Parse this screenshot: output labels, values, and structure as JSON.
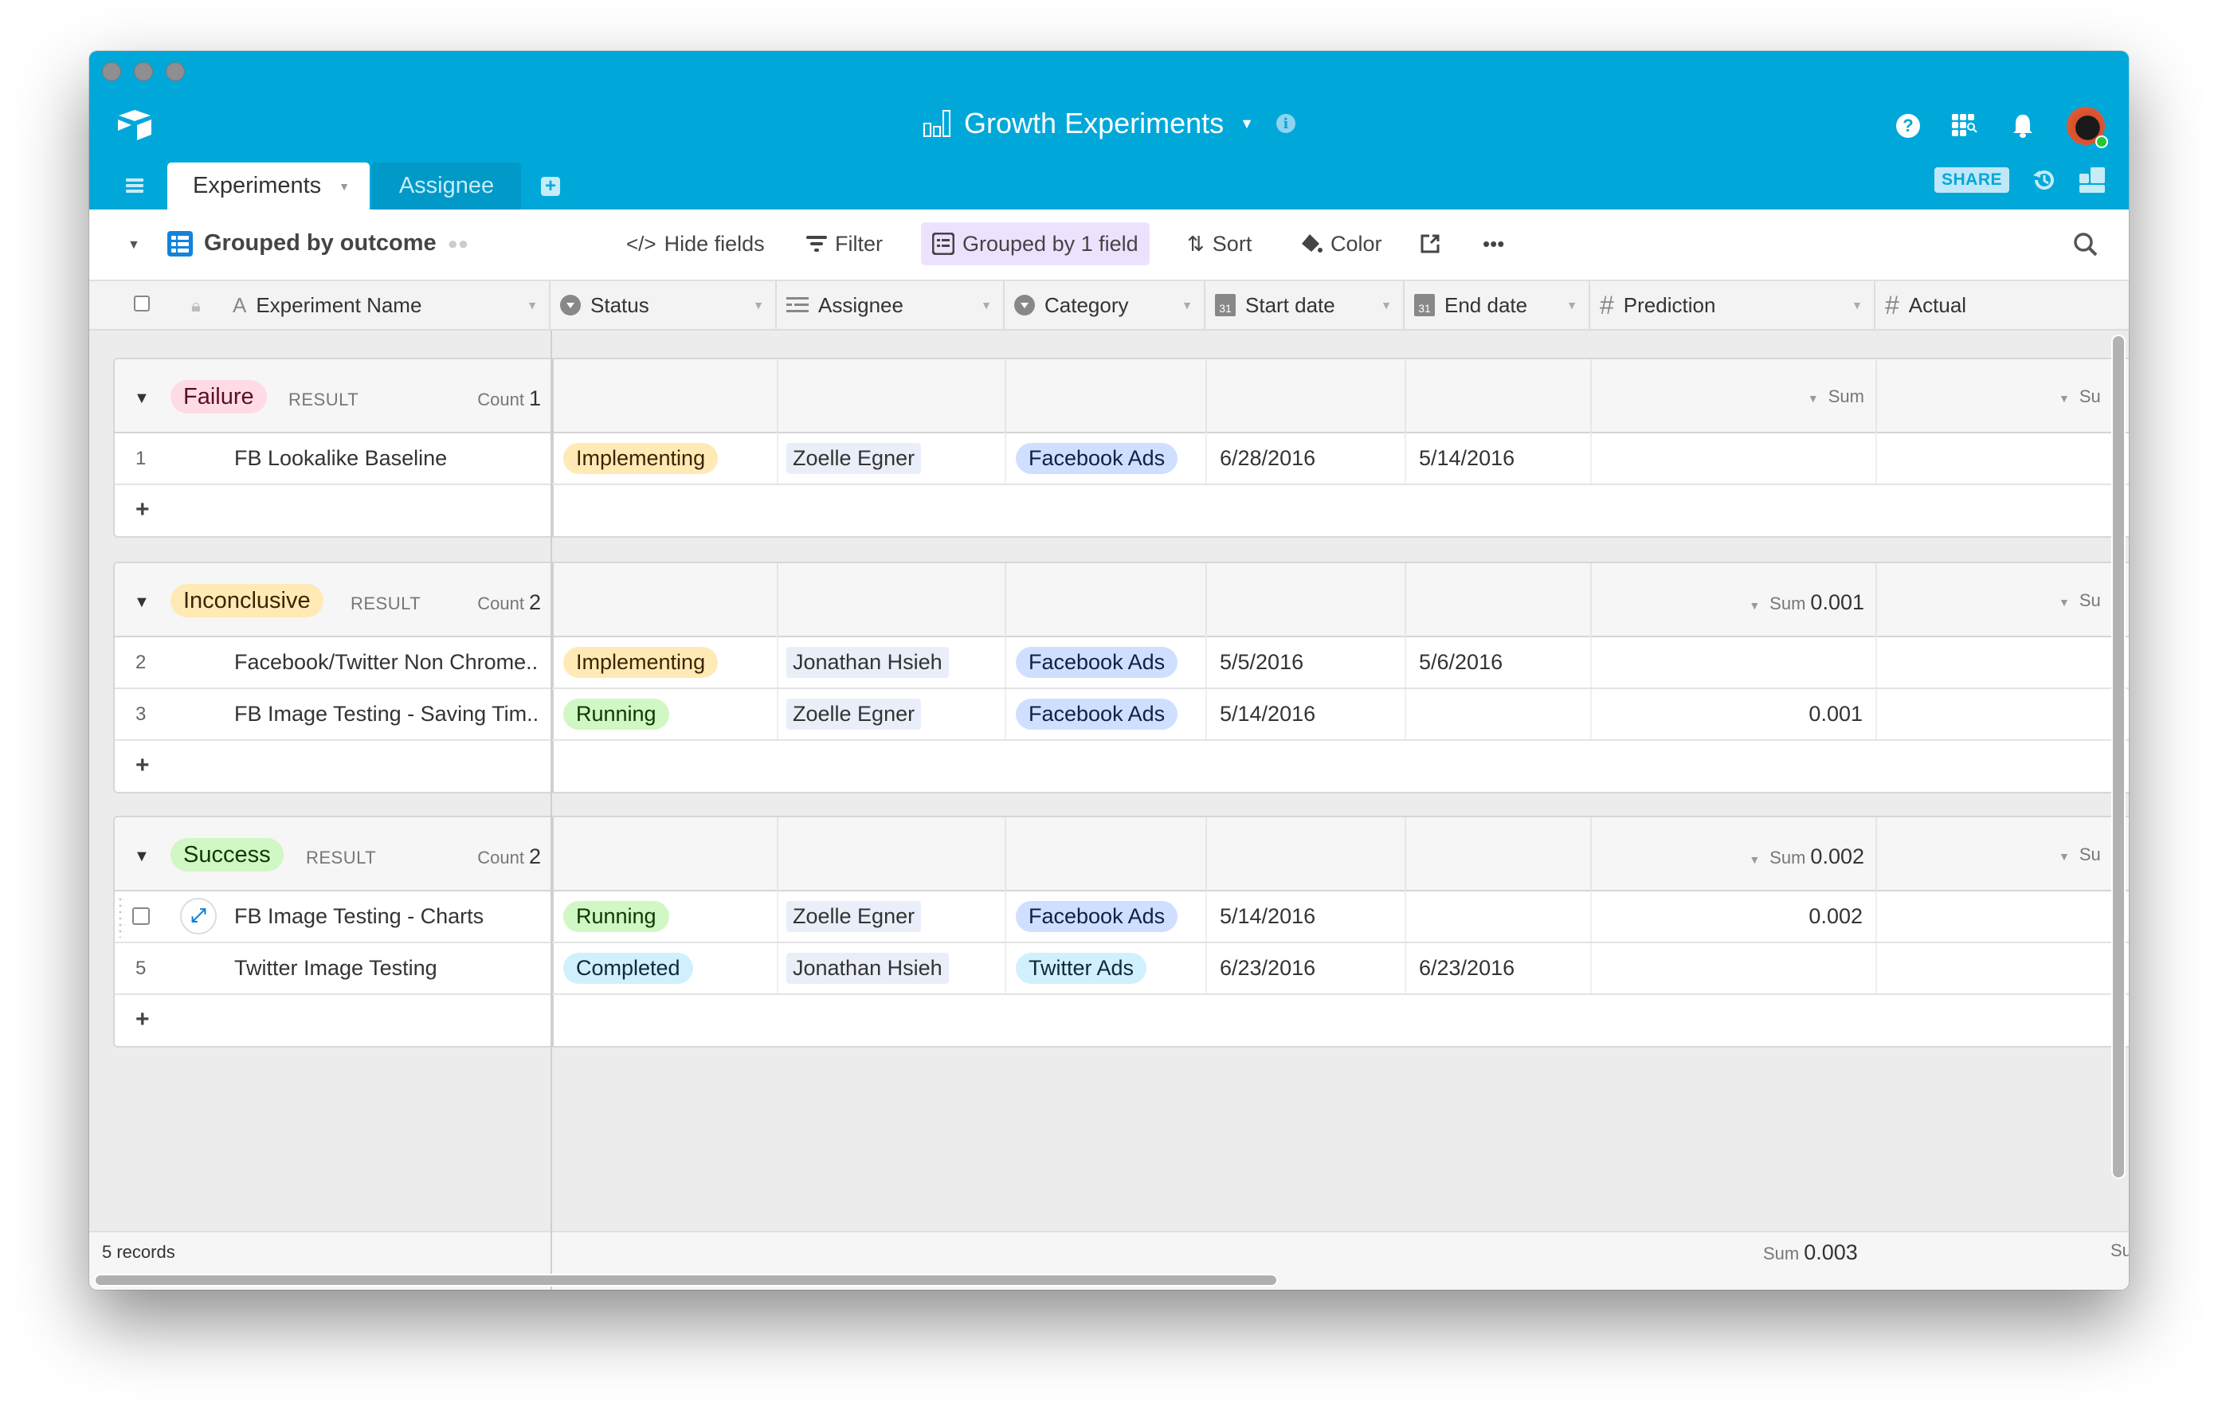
{
  "window": {
    "title": "Growth Experiments",
    "accent_color": "#00a8da"
  },
  "header": {
    "icons": [
      "help-icon",
      "apps-search-icon",
      "bell-icon",
      "avatar"
    ],
    "share_label": "SHARE"
  },
  "tabs": [
    {
      "label": "Experiments",
      "active": true
    },
    {
      "label": "Assignee",
      "active": false
    }
  ],
  "toolbar": {
    "view_name": "Grouped by outcome",
    "hide_fields": "Hide fields",
    "filter": "Filter",
    "group": "Grouped by 1 field",
    "sort": "Sort",
    "color": "Color"
  },
  "columns": [
    {
      "label": "Experiment Name",
      "icon": "text-field-icon"
    },
    {
      "label": "Status",
      "icon": "single-select-icon"
    },
    {
      "label": "Assignee",
      "icon": "collaborator-icon"
    },
    {
      "label": "Category",
      "icon": "single-select-icon"
    },
    {
      "label": "Start date",
      "icon": "calendar-icon"
    },
    {
      "label": "End date",
      "icon": "calendar-icon"
    },
    {
      "label": "Prediction",
      "icon": "number-icon"
    },
    {
      "label": "Actual",
      "icon": "number-icon"
    }
  ],
  "groups": [
    {
      "name": "Failure",
      "field_label": "RESULT",
      "count_label": "Count",
      "count": "1",
      "sum_label": "Sum",
      "sum_value": "",
      "actual_sum_label": "Su",
      "badge_bg": "#ffdce5",
      "badge_fg": "#5a0e27",
      "rows": [
        {
          "num": "1",
          "name": "FB Lookalike Baseline",
          "status": "Implementing",
          "assignee": "Zoelle Egner",
          "category": "Facebook Ads",
          "start": "6/28/2016",
          "end": "5/14/2016",
          "prediction": "",
          "actual": ""
        }
      ]
    },
    {
      "name": "Inconclusive",
      "field_label": "RESULT",
      "count_label": "Count",
      "count": "2",
      "sum_label": "Sum",
      "sum_value": "0.001",
      "actual_sum_label": "Su",
      "badge_bg": "#ffeab6",
      "badge_fg": "#3b2400",
      "rows": [
        {
          "num": "2",
          "name": "Facebook/Twitter Non Chrome..",
          "status": "Implementing",
          "assignee": "Jonathan Hsieh",
          "category": "Facebook Ads",
          "start": "5/5/2016",
          "end": "5/6/2016",
          "prediction": "",
          "actual": ""
        },
        {
          "num": "3",
          "name": "FB Image Testing - Saving Tim..",
          "status": "Running",
          "assignee": "Zoelle Egner",
          "category": "Facebook Ads",
          "start": "5/14/2016",
          "end": "",
          "prediction": "0.001",
          "actual": ""
        }
      ]
    },
    {
      "name": "Success",
      "field_label": "RESULT",
      "count_label": "Count",
      "count": "2",
      "sum_label": "Sum",
      "sum_value": "0.002",
      "actual_sum_label": "Su",
      "badge_bg": "#d1f7c4",
      "badge_fg": "#0b3b00",
      "rows": [
        {
          "num": "",
          "name": "FB Image Testing - Charts",
          "status": "Running",
          "assignee": "Zoelle Egner",
          "category": "Facebook Ads",
          "start": "5/14/2016",
          "end": "",
          "prediction": "0.002",
          "actual": "",
          "hovered": true
        },
        {
          "num": "5",
          "name": "Twitter Image Testing",
          "status": "Completed",
          "assignee": "Jonathan Hsieh",
          "category": "Twitter Ads",
          "start": "6/23/2016",
          "end": "6/23/2016",
          "prediction": "",
          "actual": ""
        }
      ]
    }
  ],
  "status_colors": {
    "Implementing": {
      "bg": "#ffeab6",
      "fg": "#3b2400"
    },
    "Running": {
      "bg": "#d1f7c4",
      "fg": "#0b3b00"
    },
    "Completed": {
      "bg": "#d0f0fd",
      "fg": "#0b2a3b"
    }
  },
  "category_colors": {
    "Facebook Ads": {
      "bg": "#cfdfff",
      "fg": "#102046"
    },
    "Twitter Ads": {
      "bg": "#d0f0fd",
      "fg": "#0b2a3b"
    }
  },
  "footer": {
    "records": "5 records",
    "sum_label": "Sum",
    "sum_value": "0.003",
    "actual_sum_label": "Su"
  }
}
